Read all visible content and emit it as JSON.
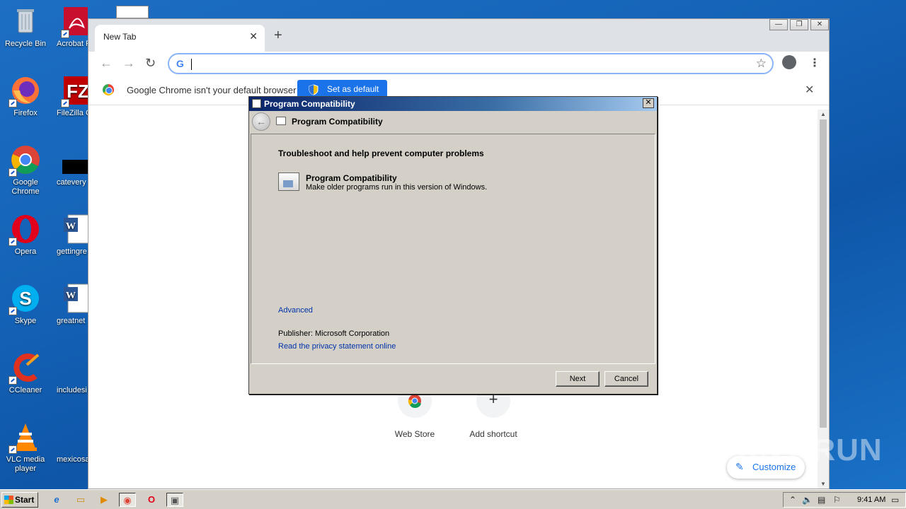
{
  "desktop": {
    "icons": [
      {
        "label": "Recycle Bin",
        "icon": "recycle-bin-icon"
      },
      {
        "label": "Acrobat Reader",
        "icon": "acrobat-icon"
      },
      {
        "label": "Firefox",
        "icon": "firefox-icon"
      },
      {
        "label": "FileZilla C",
        "icon": "filezilla-icon"
      },
      {
        "label": "Google Chrome",
        "icon": "chrome-icon"
      },
      {
        "label": "catevery",
        "icon": "file-icon"
      },
      {
        "label": "Opera",
        "icon": "opera-icon"
      },
      {
        "label": "gettingre",
        "icon": "word-doc-icon"
      },
      {
        "label": "Skype",
        "icon": "skype-icon"
      },
      {
        "label": "greatnet",
        "icon": "word-doc-icon"
      },
      {
        "label": "CCleaner",
        "icon": "ccleaner-icon"
      },
      {
        "label": "includesi",
        "icon": "file-icon"
      },
      {
        "label": "VLC media player",
        "icon": "vlc-icon"
      },
      {
        "label": "mexicosa",
        "icon": "file-icon"
      }
    ]
  },
  "browser": {
    "tab_title": "New Tab",
    "tab_close": "✕",
    "new_tab": "+",
    "back": "←",
    "forward": "→",
    "reload": "↻",
    "star": "☆",
    "menu": "⋮",
    "omnibox_logo": "G",
    "infobar": {
      "message": "Google Chrome isn't your default browser",
      "button": "Set as default",
      "close": "✕"
    },
    "shortcuts": [
      {
        "label": "Web Store",
        "icon": "web-store-icon",
        "glyph": ""
      },
      {
        "label": "Add shortcut",
        "icon": "plus-icon",
        "glyph": "+"
      }
    ],
    "customize": "Customize",
    "window_controls": {
      "minimize": "—",
      "restore": "❐",
      "close": "✕"
    }
  },
  "dialog": {
    "title": "Program Compatibility",
    "close": "✕",
    "back": "←",
    "header_title": "Program Compatibility",
    "heading": "Troubleshoot and help prevent computer problems",
    "task_title": "Program Compatibility",
    "task_desc": "Make older programs run in this version of Windows.",
    "advanced": "Advanced",
    "publisher": "Publisher:  Microsoft Corporation",
    "privacy": "Read the privacy statement online",
    "next": "Next",
    "cancel": "Cancel"
  },
  "taskbar": {
    "start": "Start",
    "items": [
      {
        "icon": "ie-icon",
        "glyph": "e"
      },
      {
        "icon": "explorer-icon",
        "glyph": "▭"
      },
      {
        "icon": "media-player-icon",
        "glyph": "▶"
      },
      {
        "icon": "chrome-icon",
        "glyph": "◉"
      },
      {
        "icon": "opera-icon",
        "glyph": "O"
      },
      {
        "icon": "program-compat-icon",
        "glyph": "▣"
      }
    ],
    "clock": "9:41 AM"
  },
  "watermark": "ANY RUN",
  "colors": {
    "accent": "#1a73e8",
    "title_bar": "#0a246a",
    "dialog_bg": "#d4d0c8"
  }
}
